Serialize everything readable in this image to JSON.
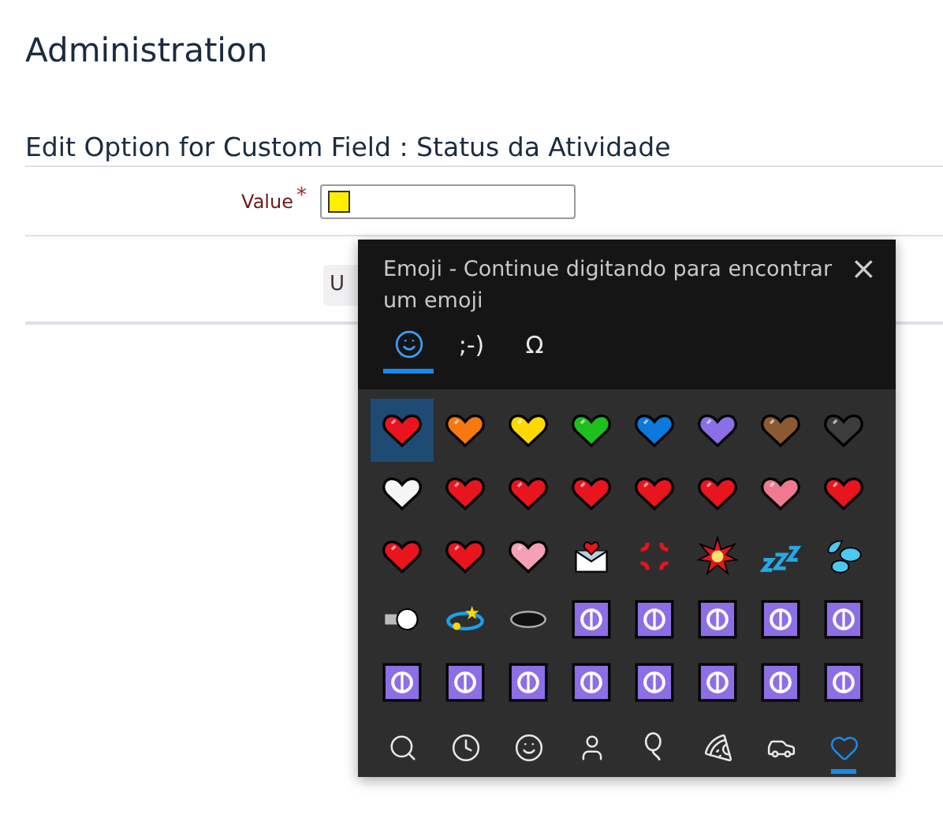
{
  "page_title": "Administration",
  "section_title": "Edit Option for Custom Field : Status da Atividade",
  "form": {
    "label": "Value",
    "required_mark": "*",
    "button": "U"
  },
  "emoji_panel": {
    "title": "Emoji - Continue digitando para encontrar um emoji",
    "close": "×",
    "tabs": [
      {
        "kind": "smiley",
        "selected": true
      },
      {
        "kind": "text",
        "label": ";-)",
        "selected": false
      },
      {
        "kind": "text",
        "label": "Ω",
        "selected": false
      }
    ],
    "emojis": [
      {
        "kind": "heart",
        "color": "#e8141e",
        "selected": true
      },
      {
        "kind": "heart",
        "color": "#f7780f",
        "selected": false
      },
      {
        "kind": "heart",
        "color": "#ffd800",
        "selected": false
      },
      {
        "kind": "heart",
        "color": "#1fbf1f",
        "selected": false
      },
      {
        "kind": "heart",
        "color": "#0a78dc",
        "selected": false
      },
      {
        "kind": "heart",
        "color": "#8c6ee6",
        "selected": false
      },
      {
        "kind": "heart",
        "color": "#8c5a32",
        "selected": false
      },
      {
        "kind": "heart",
        "color": "#3c3c3c",
        "selected": false
      },
      {
        "kind": "heart",
        "color": "#f5f5f5",
        "selected": false
      },
      {
        "kind": "heart",
        "color": "#e8141e",
        "selected": false
      },
      {
        "kind": "heart",
        "color": "#e8141e",
        "selected": false
      },
      {
        "kind": "heart",
        "color": "#e8141e",
        "selected": false
      },
      {
        "kind": "heart",
        "color": "#e8141e",
        "selected": false
      },
      {
        "kind": "heart",
        "color": "#e8141e",
        "selected": false
      },
      {
        "kind": "heart",
        "color": "#f07890",
        "selected": false
      },
      {
        "kind": "heart",
        "color": "#e8141e",
        "selected": false
      },
      {
        "kind": "heart",
        "color": "#e8141e",
        "selected": false
      },
      {
        "kind": "heart",
        "color": "#e8141e",
        "selected": false
      },
      {
        "kind": "heart",
        "color": "#f5a0b4",
        "selected": false
      },
      {
        "kind": "envelope",
        "selected": false
      },
      {
        "kind": "anger",
        "selected": false
      },
      {
        "kind": "collision",
        "selected": false
      },
      {
        "kind": "sleep",
        "selected": false
      },
      {
        "kind": "droplets",
        "selected": false
      },
      {
        "kind": "dash",
        "selected": false
      },
      {
        "kind": "dizzy",
        "selected": false
      },
      {
        "kind": "hole",
        "selected": false
      },
      {
        "kind": "symbol",
        "selected": false
      },
      {
        "kind": "symbol",
        "selected": false
      },
      {
        "kind": "symbol",
        "selected": false
      },
      {
        "kind": "symbol",
        "selected": false
      },
      {
        "kind": "symbol",
        "selected": false
      },
      {
        "kind": "symbol",
        "selected": false
      },
      {
        "kind": "symbol",
        "selected": false
      },
      {
        "kind": "symbol",
        "selected": false
      },
      {
        "kind": "symbol",
        "selected": false
      },
      {
        "kind": "symbol",
        "selected": false
      },
      {
        "kind": "symbol",
        "selected": false
      },
      {
        "kind": "symbol",
        "selected": false
      },
      {
        "kind": "symbol",
        "selected": false
      }
    ],
    "categories": [
      {
        "kind": "search",
        "selected": false
      },
      {
        "kind": "recent",
        "selected": false
      },
      {
        "kind": "smileys",
        "selected": false
      },
      {
        "kind": "people",
        "selected": false
      },
      {
        "kind": "celebration",
        "selected": false
      },
      {
        "kind": "food",
        "selected": false
      },
      {
        "kind": "travel",
        "selected": false
      },
      {
        "kind": "symbols",
        "selected": true
      }
    ]
  }
}
